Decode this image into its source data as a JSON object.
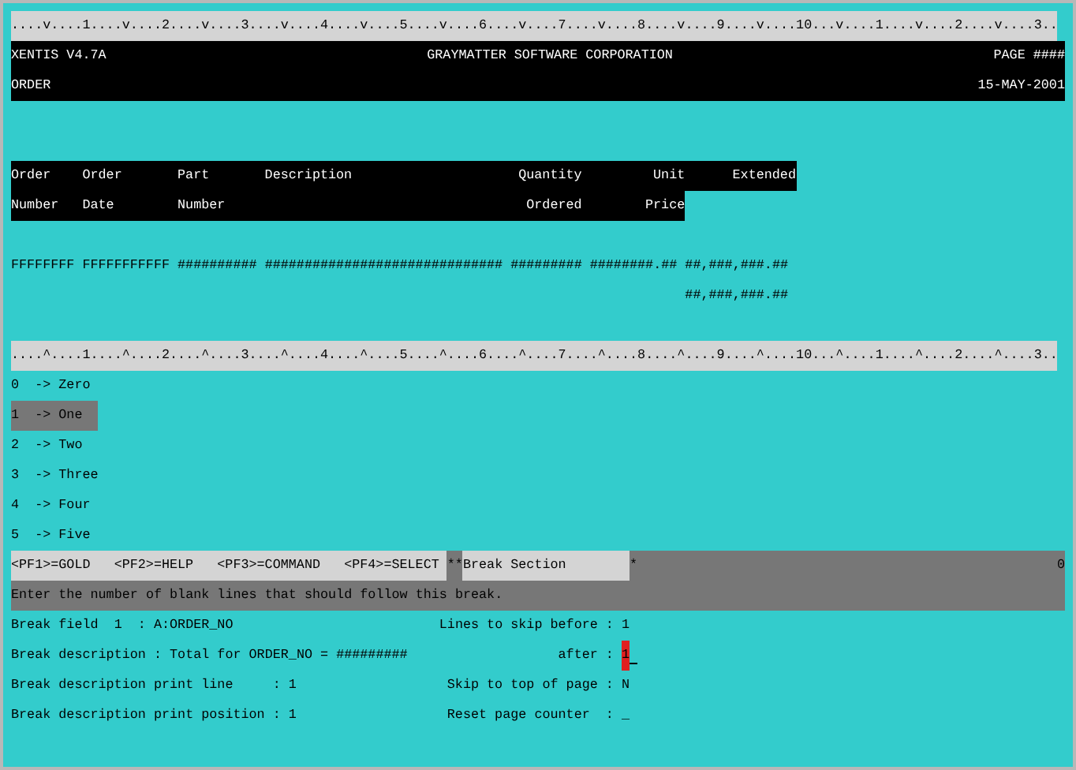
{
  "ruler_top": "....v....1....v....2....v....3....v....4....v....5....v....6....v....7....v....8....v....9....v....10...v....1....v....2....v....3..",
  "header": {
    "product": "XENTIS V4.7A",
    "company": "GRAYMATTER SOFTWARE CORPORATION",
    "page": "PAGE ####",
    "report": "ORDER",
    "date": "15-MAY-2001"
  },
  "columns": [
    {
      "line_1": "Order",
      "line_2": "Number"
    },
    {
      "line_1": "Order",
      "line_2": "Date"
    },
    {
      "line_1": "Part",
      "line_2": "Number"
    },
    {
      "line_1": "Description"
    },
    {
      "line_1": "Quantity",
      "line_2": "Ordered"
    },
    {
      "line_1": "Unit",
      "line_2": "Price"
    },
    {
      "line_1": "Extended"
    }
  ],
  "detail_lines": [
    {
      "fields": [
        "FFFFFFFF",
        "FFFFFFFFFFF",
        "##########",
        "##############################",
        "#########",
        "########.##",
        "##,###,###.##"
      ]
    },
    {
      "fields": [
        "##,###,###.##"
      ]
    }
  ],
  "ruler_bottom": "....^....1....^....2....^....3....^....4....^....5....^....6....^....7....^....8....^....9....^....10...^....1....^....2....^....3..",
  "choices": [
    {
      "key": "0",
      "label": "-> Zero",
      "selected": false
    },
    {
      "key": "1",
      "label": "-> One",
      "selected": true
    },
    {
      "key": "2",
      "label": "-> Two",
      "selected": false
    },
    {
      "key": "3",
      "label": "-> Three",
      "selected": false
    },
    {
      "key": "4",
      "label": "-> Four",
      "selected": false
    },
    {
      "key": "5",
      "label": "-> Five",
      "selected": false
    }
  ],
  "status_bar": {
    "keys": [
      "<PF1>=GOLD",
      "<PF2>=HELP",
      "<PF3>=COMMAND",
      "<PF4>=SELECT"
    ],
    "marker": "**",
    "section": "Break Section",
    "flag": "*",
    "count": "0"
  },
  "message": "Enter the number of blank lines that should follow this break.",
  "form_rows": [
    {
      "left": {
        "label": "Break field  1  :",
        "value": "A:ORDER_NO"
      },
      "right": {
        "label": "Lines to skip before :",
        "value": "1",
        "cursor": false
      }
    },
    {
      "left": {
        "label": "Break description :",
        "value": "Total for ORDER_NO = #########"
      },
      "right": {
        "label": "after :",
        "value": "1",
        "cursor": true
      }
    },
    {
      "left": {
        "label": "Break description print line     :",
        "value": "1"
      },
      "right": {
        "label": "Skip to top of page :",
        "value": "N",
        "cursor": false
      }
    },
    {
      "left": {
        "label": "Break description print position :",
        "value": "1"
      },
      "right": {
        "label": "Reset page counter  :",
        "value": "_",
        "cursor": false
      }
    }
  ]
}
